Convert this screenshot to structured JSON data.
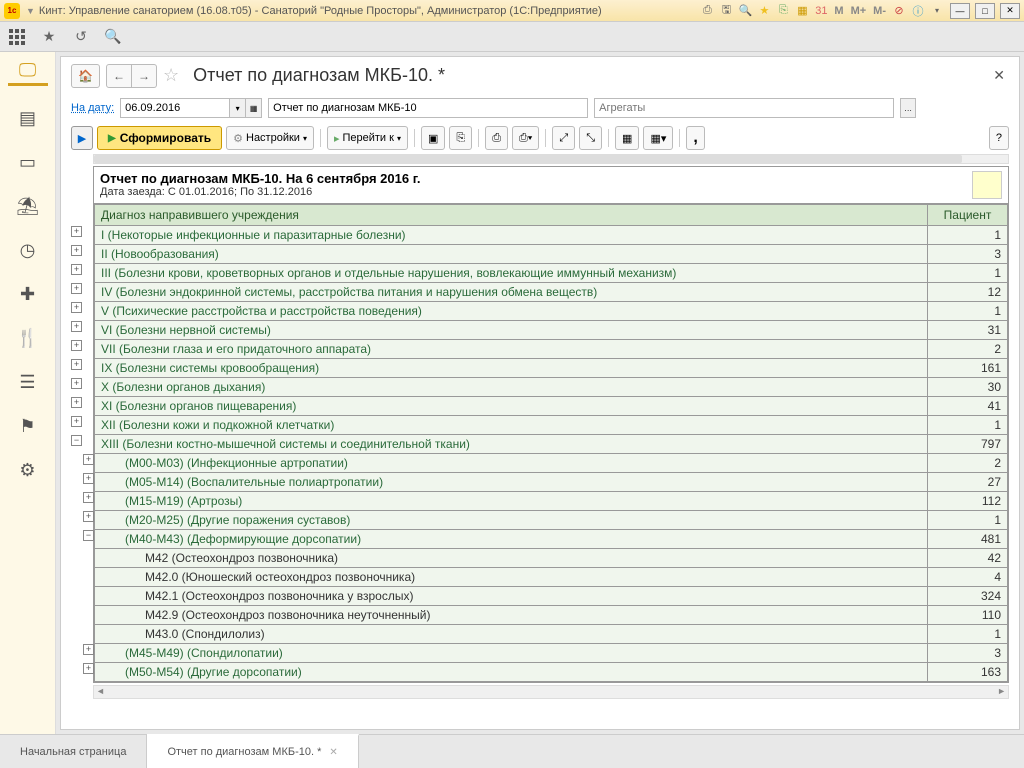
{
  "titlebar": {
    "text": "Кинт: Управление санаторием (16.08.т05) - Санаторий \"Родные Просторы\", Администратор (1С:Предприятие)",
    "m_buttons": [
      "M",
      "M+",
      "M-"
    ]
  },
  "page": {
    "title": "Отчет по диагнозам МКБ-10. *"
  },
  "filter": {
    "date_label": "На дату:",
    "date_value": "06.09.2016",
    "report_name": "Отчет по диагнозам МКБ-10",
    "aggregates_placeholder": "Агрегаты"
  },
  "toolbar": {
    "form_label": "Сформировать",
    "settings_label": "Настройки",
    "goto_label": "Перейти к"
  },
  "report": {
    "title": "Отчет по диагнозам МКБ-10. На 6 сентября 2016 г.",
    "subtitle": "Дата заезда: С 01.01.2016; По 31.12.2016",
    "col_diagnosis": "Диагноз направившего учреждения",
    "col_patient": "Пациент",
    "rows": [
      {
        "toggle": "+",
        "level": 0,
        "name": "I (Некоторые инфекционные и паразитарные болезни)",
        "count": "1"
      },
      {
        "toggle": "+",
        "level": 0,
        "name": "II (Новообразования)",
        "count": "3"
      },
      {
        "toggle": "+",
        "level": 0,
        "name": "III (Болезни крови, кроветворных органов и отдельные нарушения, вовлекающие иммунный механизм)",
        "count": "1"
      },
      {
        "toggle": "+",
        "level": 0,
        "name": "IV (Болезни эндокринной системы, расстройства питания и нарушения обмена веществ)",
        "count": "12"
      },
      {
        "toggle": "+",
        "level": 0,
        "name": "V (Психические расстройства и расстройства поведения)",
        "count": "1"
      },
      {
        "toggle": "+",
        "level": 0,
        "name": "VI (Болезни нервной системы)",
        "count": "31"
      },
      {
        "toggle": "+",
        "level": 0,
        "name": "VII (Болезни глаза и его придаточного аппарата)",
        "count": "2"
      },
      {
        "toggle": "+",
        "level": 0,
        "name": "IX (Болезни системы кровообращения)",
        "count": "161"
      },
      {
        "toggle": "+",
        "level": 0,
        "name": "X (Болезни органов дыхания)",
        "count": "30"
      },
      {
        "toggle": "+",
        "level": 0,
        "name": "XI (Болезни органов пищеварения)",
        "count": "41"
      },
      {
        "toggle": "+",
        "level": 0,
        "name": "XII (Болезни кожи и подкожной клетчатки)",
        "count": "1"
      },
      {
        "toggle": "−",
        "level": 0,
        "name": "XIII (Болезни костно-мышечной системы и соединительной ткани)",
        "count": "797"
      },
      {
        "toggle": "+",
        "level": 1,
        "name": "(M00-M03) (Инфекционные артропатии)",
        "count": "2"
      },
      {
        "toggle": "+",
        "level": 1,
        "name": "(M05-M14) (Воспалительные полиартропатии)",
        "count": "27"
      },
      {
        "toggle": "+",
        "level": 1,
        "name": "(M15-M19) (Артрозы)",
        "count": "112"
      },
      {
        "toggle": "+",
        "level": 1,
        "name": "(M20-M25) (Другие поражения суставов)",
        "count": "1"
      },
      {
        "toggle": "−",
        "level": 1,
        "name": "(M40-M43) (Деформирующие дорсопатии)",
        "count": "481"
      },
      {
        "toggle": "",
        "level": 2,
        "name": "M42 (Остеохондроз позвоночника)",
        "count": "42"
      },
      {
        "toggle": "",
        "level": 2,
        "name": "M42.0 (Юношеский остеохондроз позвоночника)",
        "count": "4"
      },
      {
        "toggle": "",
        "level": 2,
        "name": "M42.1 (Остеохондроз позвоночника у взрослых)",
        "count": "324"
      },
      {
        "toggle": "",
        "level": 2,
        "name": "M42.9 (Остеохондроз позвоночника неуточненный)",
        "count": "110"
      },
      {
        "toggle": "",
        "level": 2,
        "name": "M43.0 (Спондилолиз)",
        "count": "1"
      },
      {
        "toggle": "+",
        "level": 1,
        "name": "(M45-M49) (Спондилопатии)",
        "count": "3"
      },
      {
        "toggle": "+",
        "level": 1,
        "name": "(M50-M54) (Другие дорсопатии)",
        "count": "163"
      }
    ]
  },
  "tabs": {
    "home": "Начальная страница",
    "report": "Отчет по диагнозам МКБ-10. *"
  }
}
